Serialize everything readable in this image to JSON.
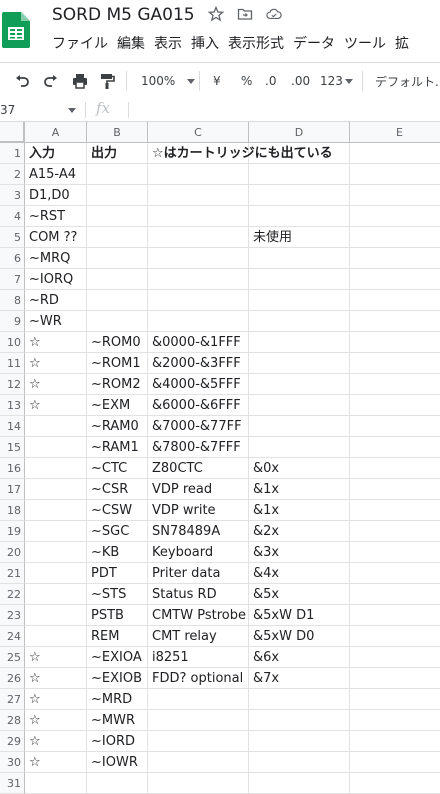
{
  "app": {
    "title": "SORD M5 GA015",
    "logo_color": "#0f9d58"
  },
  "menu": [
    "ファイル",
    "編集",
    "表示",
    "挿入",
    "表示形式",
    "データ",
    "ツール",
    "拡"
  ],
  "toolbar": {
    "zoom": "100%",
    "currency": "¥",
    "percent": "%",
    "dec_decrease": ".0",
    "dec_increase": ".00",
    "number_format": "123",
    "font": "デフォルト..."
  },
  "formula_bar": {
    "name_box": "37",
    "fx": "fx"
  },
  "columns": [
    "A",
    "B",
    "C",
    "D",
    "E"
  ],
  "rows": [
    {
      "num": "1",
      "a": "入力",
      "b": "出力",
      "c": "☆はカートリッジにも出ている",
      "d": "",
      "bold": true
    },
    {
      "num": "2",
      "a": "A15-A4",
      "b": "",
      "c": "",
      "d": ""
    },
    {
      "num": "3",
      "a": "D1,D0",
      "b": "",
      "c": "",
      "d": ""
    },
    {
      "num": "4",
      "a": "~RST",
      "b": "",
      "c": "",
      "d": ""
    },
    {
      "num": "5",
      "a": "COM ??",
      "b": "",
      "c": "",
      "d": "未使用"
    },
    {
      "num": "6",
      "a": "~MRQ",
      "b": "",
      "c": "",
      "d": ""
    },
    {
      "num": "7",
      "a": "~IORQ",
      "b": "",
      "c": "",
      "d": ""
    },
    {
      "num": "8",
      "a": "~RD",
      "b": "",
      "c": "",
      "d": ""
    },
    {
      "num": "9",
      "a": "~WR",
      "b": "",
      "c": "",
      "d": ""
    },
    {
      "num": "10",
      "a": "☆",
      "b": "~ROM0",
      "c": "&0000-&1FFF",
      "d": ""
    },
    {
      "num": "11",
      "a": "☆",
      "b": "~ROM1",
      "c": "&2000-&3FFF",
      "d": ""
    },
    {
      "num": "12",
      "a": "☆",
      "b": "~ROM2",
      "c": "&4000-&5FFF",
      "d": ""
    },
    {
      "num": "13",
      "a": "☆",
      "b": "~EXM",
      "c": "&6000-&6FFF",
      "d": ""
    },
    {
      "num": "14",
      "a": "",
      "b": "~RAM0",
      "c": "&7000-&77FF",
      "d": ""
    },
    {
      "num": "15",
      "a": "",
      "b": "~RAM1",
      "c": "&7800-&7FFF",
      "d": ""
    },
    {
      "num": "16",
      "a": "",
      "b": "~CTC",
      "c": "Z80CTC",
      "d": "&0x"
    },
    {
      "num": "17",
      "a": "",
      "b": "~CSR",
      "c": "VDP read",
      "d": "&1x"
    },
    {
      "num": "18",
      "a": "",
      "b": "~CSW",
      "c": "VDP write",
      "d": "&1x"
    },
    {
      "num": "19",
      "a": "",
      "b": "~SGC",
      "c": "SN78489A",
      "d": "&2x"
    },
    {
      "num": "20",
      "a": "",
      "b": "~KB",
      "c": "Keyboard",
      "d": "&3x"
    },
    {
      "num": "21",
      "a": "",
      "b": "PDT",
      "c": "Priter data",
      "d": "&4x"
    },
    {
      "num": "22",
      "a": "",
      "b": "~STS",
      "c": "Status RD",
      "d": "&5x"
    },
    {
      "num": "23",
      "a": "",
      "b": "PSTB",
      "c": "CMTW Pstrobe",
      "d": "&5xW D1"
    },
    {
      "num": "24",
      "a": "",
      "b": "REM",
      "c": "CMT relay",
      "d": "&5xW D0"
    },
    {
      "num": "25",
      "a": "☆",
      "b": "~EXIOA",
      "c": "i8251",
      "d": "&6x"
    },
    {
      "num": "26",
      "a": "☆",
      "b": "~EXIOB",
      "c": "FDD? optional",
      "d": "&7x"
    },
    {
      "num": "27",
      "a": "☆",
      "b": "~MRD",
      "c": "",
      "d": ""
    },
    {
      "num": "28",
      "a": "☆",
      "b": "~MWR",
      "c": "",
      "d": ""
    },
    {
      "num": "29",
      "a": "☆",
      "b": "~IORD",
      "c": "",
      "d": ""
    },
    {
      "num": "30",
      "a": "☆",
      "b": "~IOWR",
      "c": "",
      "d": ""
    },
    {
      "num": "31",
      "a": "",
      "b": "",
      "c": "",
      "d": ""
    }
  ]
}
